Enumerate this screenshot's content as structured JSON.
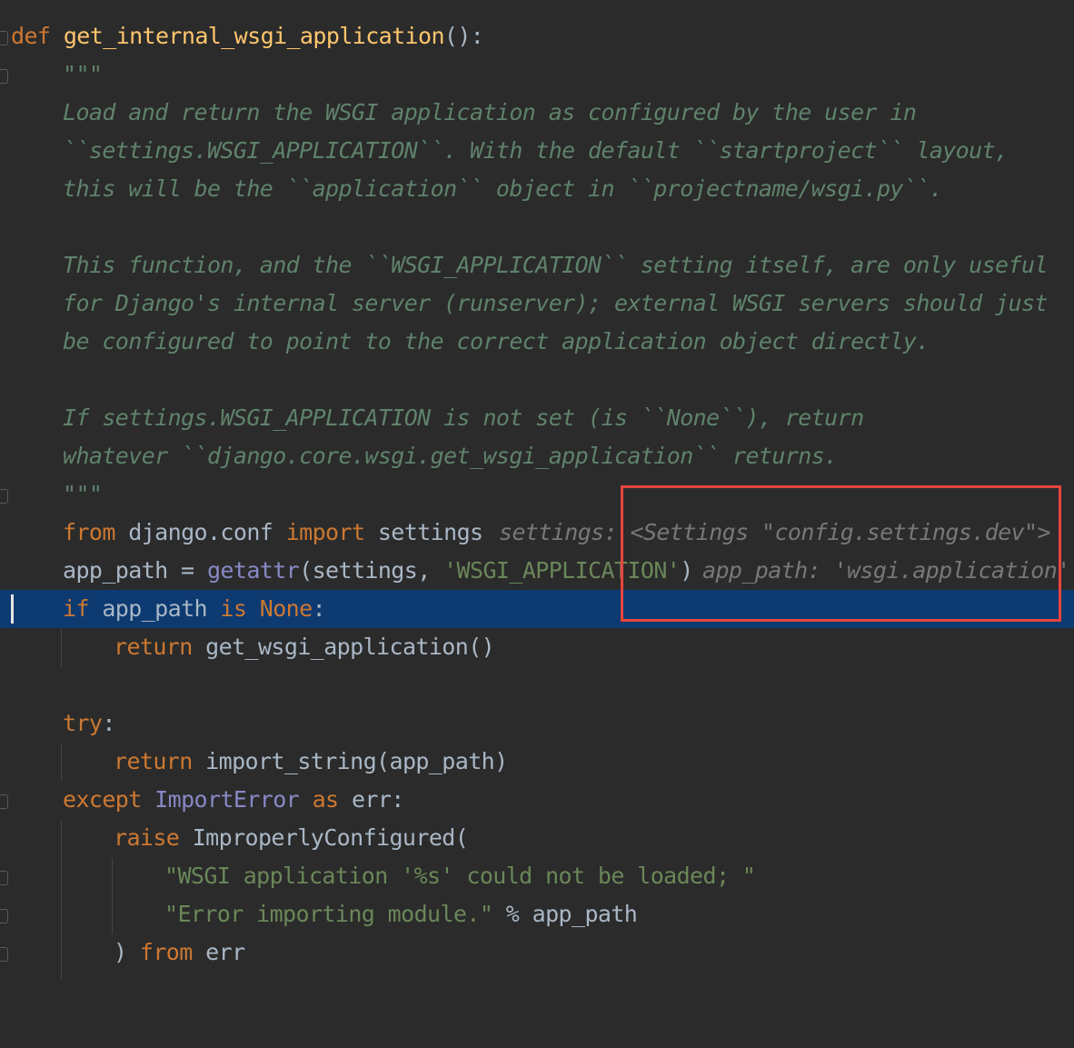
{
  "code": {
    "l1": {
      "def": "def",
      "name": "get_internal_wsgi_application",
      "tail": "():"
    },
    "l2": {
      "text": "\"\"\""
    },
    "l3": {
      "text": "Load and return the WSGI application as configured by the user in"
    },
    "l4": {
      "text": "``settings.WSGI_APPLICATION``. With the default ``startproject`` layout,"
    },
    "l5": {
      "text": "this will be the ``application`` object in ``projectname/wsgi.py``."
    },
    "l7": {
      "text": "This function, and the ``WSGI_APPLICATION`` setting itself, are only useful"
    },
    "l8": {
      "text": "for Django's internal server (runserver); external WSGI servers should just"
    },
    "l9": {
      "text": "be configured to point to the correct application object directly."
    },
    "l11": {
      "text": "If settings.WSGI_APPLICATION is not set (is ``None``), return"
    },
    "l12": {
      "text": "whatever ``django.core.wsgi.get_wsgi_application`` returns."
    },
    "l13": {
      "text": "\"\"\""
    },
    "l14": {
      "from": "from",
      "module": " django.conf ",
      "import": "import",
      "name": " settings"
    },
    "l15": {
      "var": "app_path = ",
      "func": "getattr",
      "open": "(settings, ",
      "str": "'WSGI_APPLICATION'",
      "close": ")"
    },
    "l16": {
      "if": "if",
      "var": " app_path ",
      "is": "is",
      "sp": " ",
      "none": "None",
      "colon": ":"
    },
    "l17": {
      "return": "return",
      "rest": " get_wsgi_application()"
    },
    "l19": {
      "try": "try",
      "colon": ":"
    },
    "l20": {
      "return": "return",
      "rest": " import_string(app_path)"
    },
    "l21": {
      "except": "except",
      "sp": " ",
      "cls": "ImportError",
      "sp2": " ",
      "as": "as",
      "rest": " err:"
    },
    "l22": {
      "raise": "raise",
      "rest": " ImproperlyConfigured("
    },
    "l23": {
      "str": "\"WSGI application '%s' could not be loaded; \""
    },
    "l24": {
      "str": "\"Error importing module.\"",
      "rest": " % app_path"
    },
    "l25": {
      "paren": ") ",
      "from": "from",
      "rest": " err"
    }
  },
  "inlay_hints": {
    "settings": "settings: <Settings \"config.settings.dev\">",
    "app_path": "app_path: 'wsgi.application'"
  },
  "colors": {
    "background": "#2b2b2b",
    "current_line": "#0d3a71",
    "keyword": "#cc7832",
    "function": "#ffc66d",
    "string": "#6a8759",
    "docstring": "#5f826b",
    "highlight_box": "#e8453c"
  }
}
